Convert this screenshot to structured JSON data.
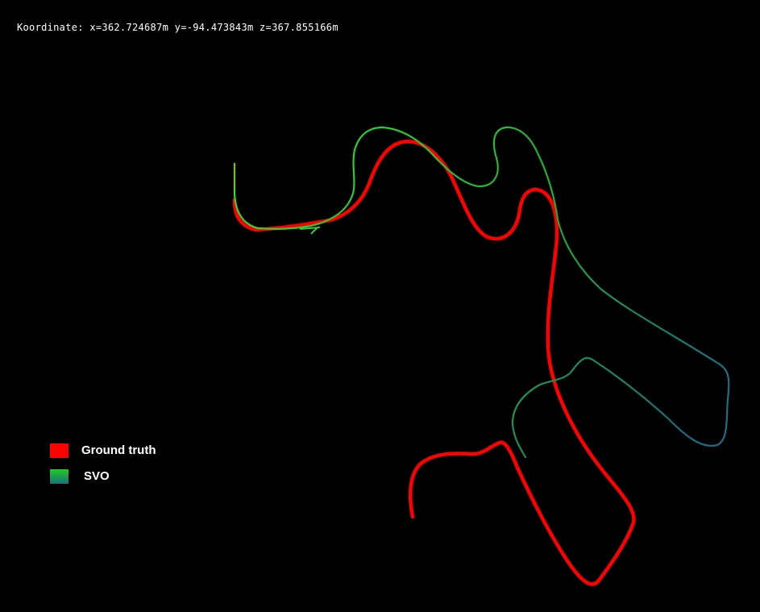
{
  "readout": {
    "label": "Koordinate:",
    "x": "x=362.724687m",
    "y": "y=-94.473843m",
    "z": "z=367.855166m"
  },
  "legend": {
    "items": [
      {
        "label": "Ground truth",
        "color": "#ff0000"
      },
      {
        "label": "SVO",
        "color_start": "#22cc22",
        "color_end": "#1a6f82"
      }
    ]
  },
  "colors": {
    "background": "#000000",
    "ground_truth": "#ff0000",
    "svo_start": "#33dd33",
    "svo_end": "#1a6f82"
  }
}
